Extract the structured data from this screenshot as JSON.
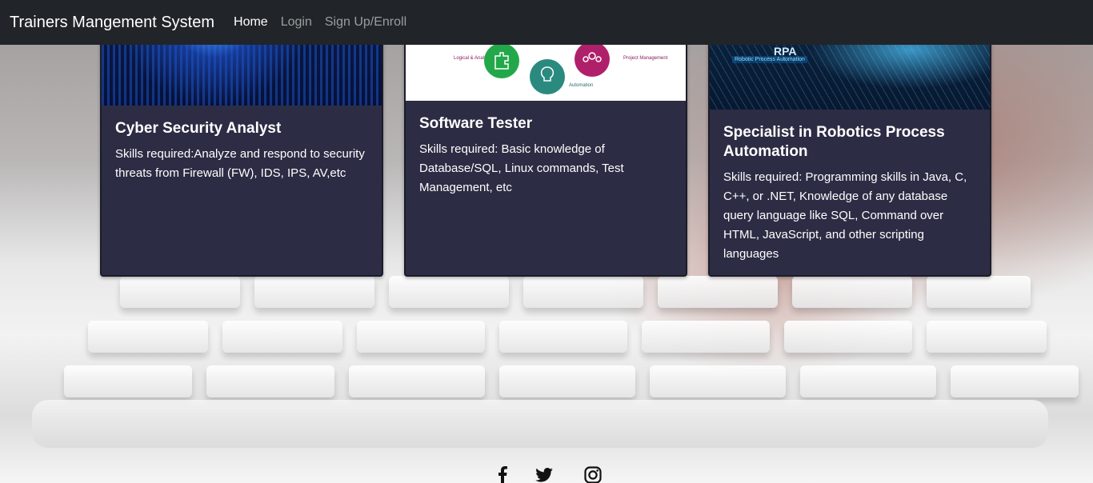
{
  "navbar": {
    "brand": "Trainers Mangement System",
    "links": [
      {
        "label": "Home",
        "active": true
      },
      {
        "label": "Login",
        "active": false
      },
      {
        "label": "Sign Up/Enroll",
        "active": false
      }
    ]
  },
  "cards": [
    {
      "title": "Cyber Security Analyst",
      "text": "Skills required:Analyze and respond to security threats from Firewall (FW), IDS, IPS, AV,etc"
    },
    {
      "title": "Software Tester",
      "text": "Skills required: Basic knowledge of Database/SQL, Linux commands, Test Management, etc",
      "image_labels": {
        "logical": "Logical & Analytical",
        "automation": "Automation",
        "project": "Project Management"
      }
    },
    {
      "title": "Specialist in Robotics Process Automation",
      "text": "Skills required: Programming skills in Java, C, C++, or .NET, Knowledge of any database query language like SQL, Command over HTML, JavaScript, and other scripting languages",
      "image_labels": {
        "big": "RPA",
        "small": "Robotic Process Automation"
      }
    }
  ],
  "footer": {
    "icons": [
      "facebook-icon",
      "twitter-icon",
      "instagram-icon"
    ]
  },
  "colors": {
    "navbar_bg": "#212529",
    "card_bg": "#2c2c44"
  }
}
